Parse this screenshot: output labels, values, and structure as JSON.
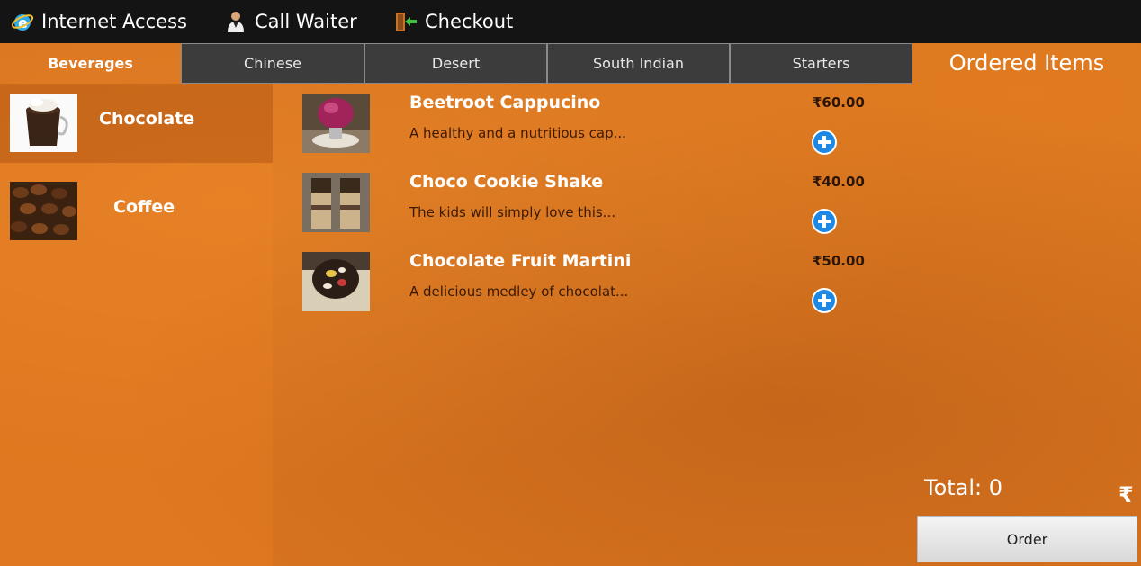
{
  "topbar": {
    "internet": "Internet Access",
    "waiter": "Call Waiter",
    "checkout": "Checkout"
  },
  "tabs": [
    "Beverages",
    "Chinese",
    "Desert",
    "South Indian",
    "Starters"
  ],
  "subcategories": [
    "Chocolate",
    "Coffee"
  ],
  "items": [
    {
      "name": "Beetroot Cappucino",
      "desc": "A healthy and a nutritious cap...",
      "price": "₹60.00"
    },
    {
      "name": "Choco Cookie Shake",
      "desc": "The kids will simply love this...",
      "price": "₹40.00"
    },
    {
      "name": "Chocolate Fruit Martini",
      "desc": "A delicious medley of chocolat...",
      "price": "₹50.00"
    }
  ],
  "order": {
    "title": "Ordered Items",
    "total_label": "Total:",
    "total_value": "0",
    "currency": "₹",
    "button": "Order"
  },
  "colors": {
    "topbar": "#141414",
    "background": "#d8741f",
    "tab": "#3c3c3c",
    "add": "#1e88e5"
  }
}
